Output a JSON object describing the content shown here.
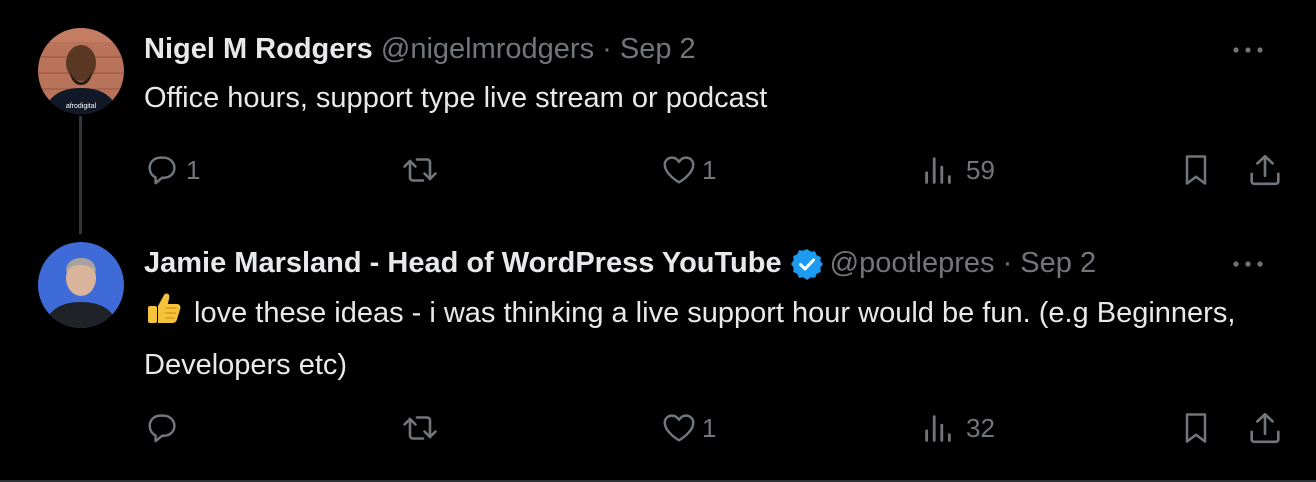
{
  "colors": {
    "background": "#000000",
    "text": "#e7e9ea",
    "muted": "#71767b",
    "verified": "#1d9bf0",
    "thread_line": "#333639"
  },
  "tweets": [
    {
      "author_name": "Nigel M Rodgers",
      "handle": "@nigelmrodgers",
      "separator": "·",
      "date": "Sep 2",
      "verified": false,
      "avatar_text": "afrodigital",
      "text": "Office hours, support type live stream or podcast",
      "emoji": "",
      "actions": {
        "replies": "1",
        "retweets": "",
        "likes": "1",
        "views": "59"
      },
      "icons": [
        "more-icon",
        "reply-icon",
        "retweet-icon",
        "like-icon",
        "views-icon",
        "bookmark-icon",
        "share-icon"
      ]
    },
    {
      "author_name": "Jamie Marsland - Head of WordPress YouTube",
      "handle": "@pootlepres",
      "separator": "·",
      "date": "Sep 2",
      "verified": true,
      "text": "love these ideas - i was thinking a live support hour would be fun. (e.g Beginners, Developers etc)",
      "emoji": "thumbs-up",
      "actions": {
        "replies": "",
        "retweets": "",
        "likes": "1",
        "views": "32"
      },
      "icons": [
        "more-icon",
        "reply-icon",
        "retweet-icon",
        "like-icon",
        "views-icon",
        "bookmark-icon",
        "share-icon"
      ]
    }
  ]
}
